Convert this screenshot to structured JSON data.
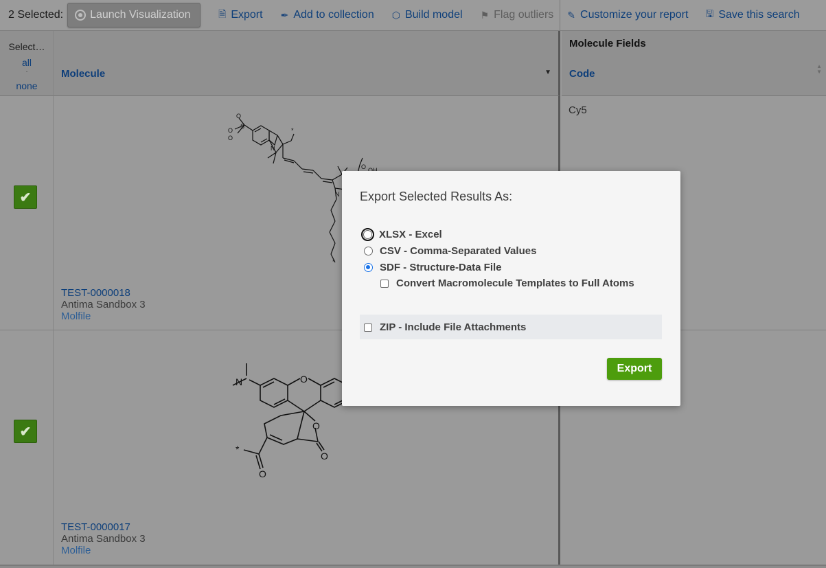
{
  "toolbar": {
    "selected_count": "2 Selected:",
    "launch_visualization": "Launch Visualization",
    "export": "Export",
    "add_to_collection": "Add to collection",
    "build_model": "Build model",
    "flag_outliers": "Flag outliers",
    "customize_report": "Customize your report",
    "save_search": "Save this search"
  },
  "grid": {
    "select_title": "Select…",
    "select_all": "all",
    "select_sep": "·",
    "select_none": "none",
    "molecule_header": "Molecule",
    "fields_title": "Molecule Fields",
    "code_header": "Code",
    "rows": [
      {
        "checked": true,
        "id": "TEST-0000018",
        "project": "Antima Sandbox 3",
        "file_link": "Molfile",
        "code": "Cy5"
      },
      {
        "checked": true,
        "id": "TEST-0000017",
        "project": "Antima Sandbox 3",
        "file_link": "Molfile",
        "code": ""
      }
    ]
  },
  "modal": {
    "title": "Export Selected Results As:",
    "options": [
      {
        "label": "XLSX - Excel",
        "selected": false
      },
      {
        "label": "CSV - Comma-Separated Values",
        "selected": false
      },
      {
        "label": "SDF - Structure-Data File",
        "selected": true
      }
    ],
    "convert_macro": {
      "label": "Convert Macromolecule Templates to Full Atoms",
      "checked": false
    },
    "zip": {
      "label": "ZIP - Include File Attachments",
      "checked": false
    },
    "export_button": "Export"
  },
  "colors": {
    "accent_link": "#0d3e7a",
    "check_green": "#3b7a12",
    "export_green": "#4d9d0d",
    "radio_blue": "#1a73e8"
  }
}
